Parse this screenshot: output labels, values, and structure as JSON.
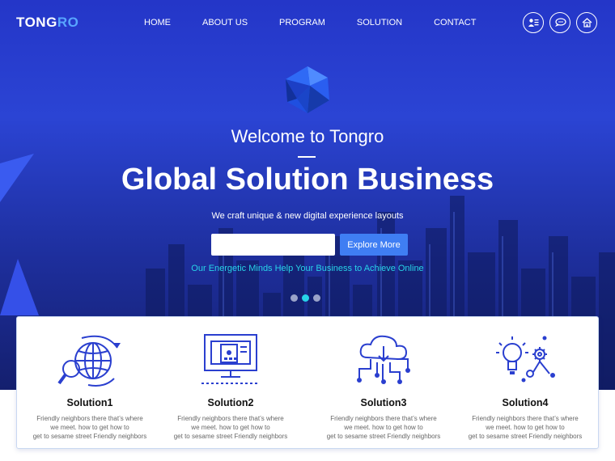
{
  "header": {
    "logo_main": "TONG",
    "logo_accent": "RO",
    "nav": [
      "HOME",
      "ABOUT US",
      "PROGRAM",
      "SOLUTION",
      "CONTACT"
    ],
    "icons": [
      "user-card-icon",
      "chat-icon",
      "home-icon"
    ]
  },
  "hero": {
    "welcome": "Welcome to Tongro",
    "headline": "Global Solution Business",
    "subtitle": "We craft unique & new digital experience layouts",
    "email_placeholder": "",
    "cta": "Explore More",
    "tagline": "Our Energetic Minds Help Your Business to Achieve Online",
    "slides": 3,
    "active_slide": 2
  },
  "solutions": [
    {
      "title": "Solution1",
      "lines": [
        "Friendly neighbors there that’s where",
        "we meet. how to get how to",
        "get to sesame street Friendly neighbors"
      ],
      "icon": "globe-search-icon"
    },
    {
      "title": "Solution2",
      "lines": [
        "Friendly neighbors there that’s where",
        "we meet. how to get how to",
        "get to sesame street Friendly neighbors"
      ],
      "icon": "monitor-icon"
    },
    {
      "title": "Solution3",
      "lines": [
        "Friendly neighbors there that’s where",
        "we meet. how to get how to",
        "get to sesame street Friendly neighbors"
      ],
      "icon": "cloud-network-icon"
    },
    {
      "title": "Solution4",
      "lines": [
        "Friendly neighbors there that’s where",
        "we meet. how to get how to",
        "get to sesame street Friendly neighbors"
      ],
      "icon": "idea-gear-icon"
    }
  ],
  "colors": {
    "hero_top": "#2436c8",
    "hero_bottom": "#141f6e",
    "accent": "#3f7ef3",
    "cyan": "#27d3e8",
    "logo_accent": "#58a6ff",
    "icon_blue": "#2a3fcf"
  }
}
